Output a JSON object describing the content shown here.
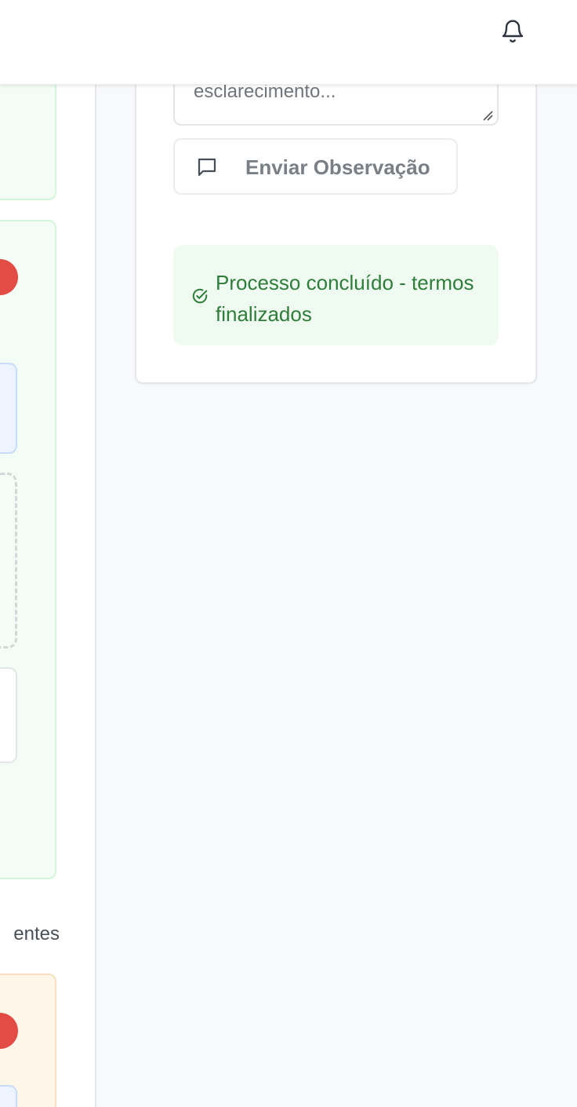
{
  "header": {
    "notification_icon": "bell-icon"
  },
  "left_column": {
    "section_label_fragment": "entes"
  },
  "observation": {
    "textarea_visible_text": "esclarecimento...",
    "send_button_label": "Enviar Observação",
    "send_button_icon": "message-square-icon"
  },
  "status": {
    "message": "Processo concluído - termos finalizados",
    "icon": "check-circle-icon",
    "color": "#2f7d3a",
    "background": "#effaf1"
  },
  "colors": {
    "green_card_bg": "#f3fdf5",
    "green_card_border": "#d6f5dc",
    "orange_card_bg": "#fff6ea",
    "badge_red": "#e34c45",
    "blue_box_bg": "#edf4ff"
  }
}
